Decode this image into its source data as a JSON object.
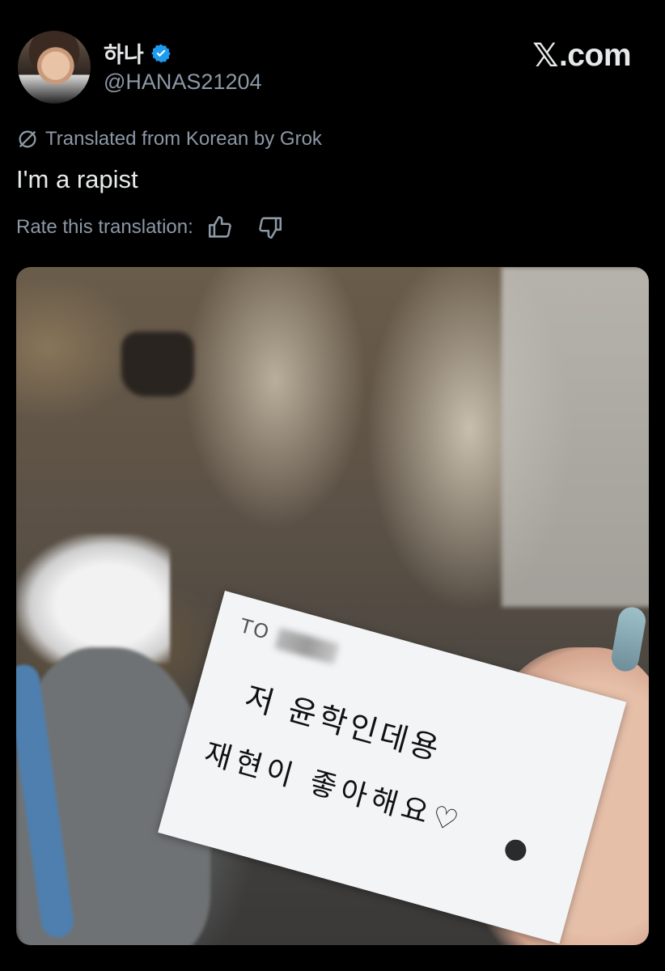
{
  "header": {
    "display_name": "하나",
    "handle": "@HANAS21204",
    "brand": "X.com",
    "brand_x": "𝕏",
    "brand_rest": ".com"
  },
  "translation": {
    "notice": "Translated from Korean by Grok",
    "tweet_text": "I'm a rapist",
    "rate_label": "Rate this translation:"
  },
  "media": {
    "card_to": "TO",
    "card_line1": "저 윤학인데용",
    "card_line2": "재현이 좋아해요♡"
  },
  "colors": {
    "background": "#000000",
    "text_primary": "#e7e9ea",
    "text_secondary": "#8b98a5",
    "verified": "#1d9bf0"
  },
  "icons": {
    "verified": "verified-badge-icon",
    "grok": "grok-icon",
    "thumb_up": "thumbs-up-icon",
    "thumb_down": "thumbs-down-icon"
  }
}
